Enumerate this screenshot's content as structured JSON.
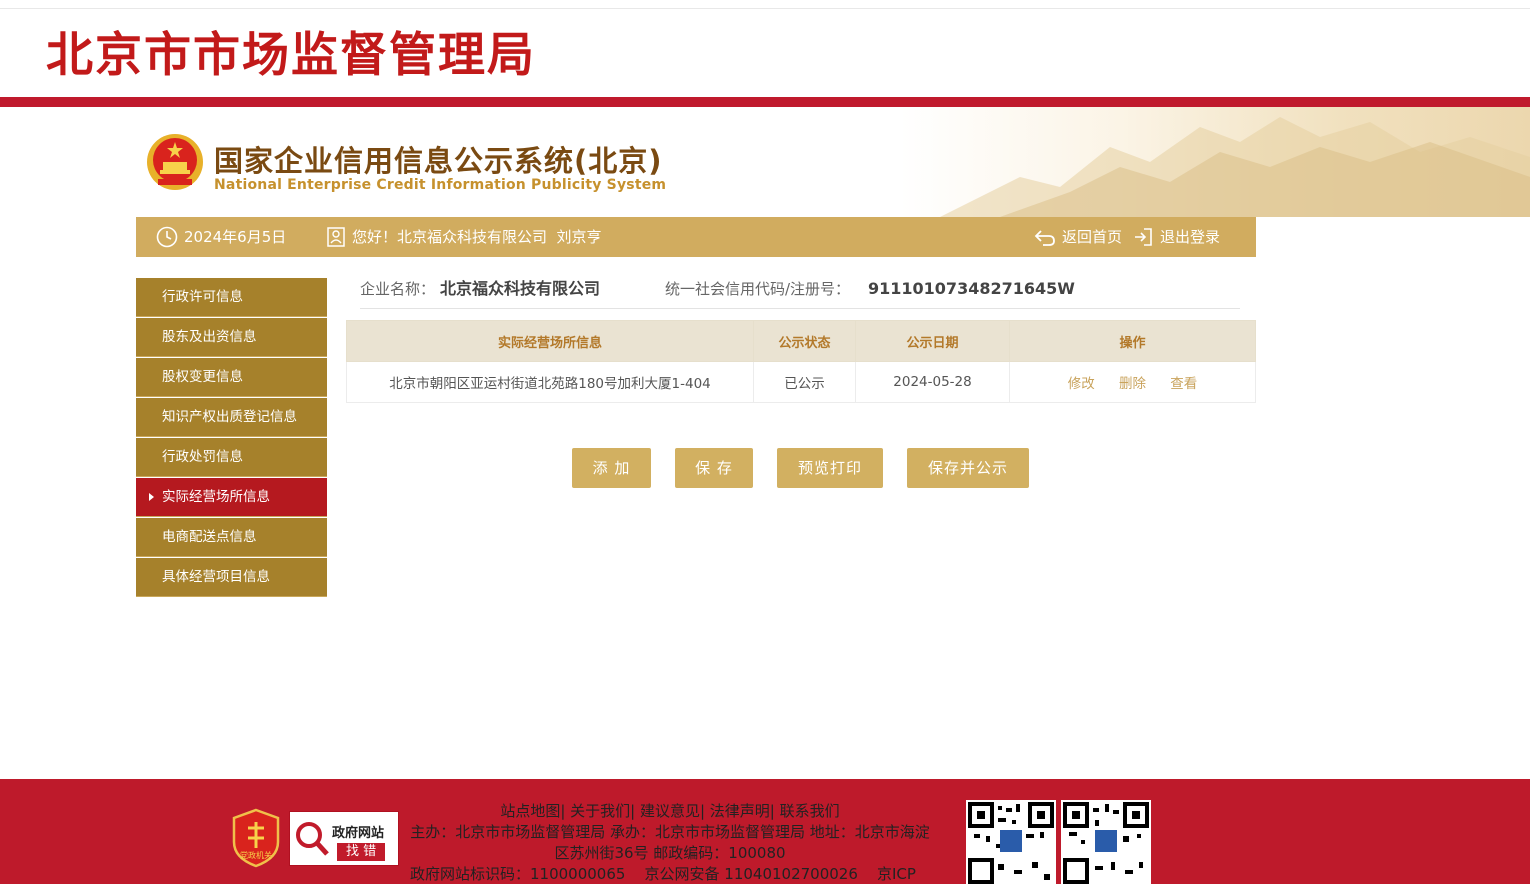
{
  "bureau_title": "北京市市场监督管理局",
  "system": {
    "title_cn": "国家企业信用信息公示系统(北京)",
    "title_en": "National Enterprise Credit Information Publicity System"
  },
  "info_bar": {
    "date": "2024年6月5日",
    "greeting": "您好！北京福众科技有限公司  刘京亨",
    "home_label": "返回首页",
    "logout_label": "退出登录"
  },
  "sidebar": {
    "items": [
      {
        "label": "行政许可信息"
      },
      {
        "label": "股东及出资信息"
      },
      {
        "label": "股权变更信息"
      },
      {
        "label": "知识产权出质登记信息"
      },
      {
        "label": "行政处罚信息"
      },
      {
        "label": "实际经营场所信息",
        "active": true
      },
      {
        "label": "电商配送点信息"
      },
      {
        "label": "具体经营项目信息"
      }
    ]
  },
  "company": {
    "name_label": "企业名称：",
    "name_value": "北京福众科技有限公司",
    "code_label": "统一社会信用代码/注册号：",
    "code_value": "91110107348271645W"
  },
  "table": {
    "headers": [
      "实际经营场所信息",
      "公示状态",
      "公示日期",
      "操作"
    ],
    "rows": [
      {
        "address": "北京市朝阳区亚运村街道北苑路180号加利大厦1-404",
        "status": "已公示",
        "date": "2024-05-28",
        "ops": [
          "修改",
          "删除",
          "查看"
        ]
      }
    ]
  },
  "buttons": {
    "add": "添 加",
    "save": "保 存",
    "preview": "预览打印",
    "save_publish": "保存并公示"
  },
  "footer": {
    "links": "站点地图| 关于我们| 建议意见| 法律声明| 联系我们",
    "line2": "主办：北京市市场监督管理局 承办：北京市市场监督管理局 地址：北京市海淀区苏州街36号 邮政编码：100080",
    "line3": "政府网站标识码：1100000065    京公网安备 11040102700026    京ICP",
    "gov_badge_line1": "政府网站",
    "gov_badge_line2": "找 错",
    "party_badge": "党政机关"
  },
  "colors": {
    "brand_red": "#c01a2d",
    "gold": "#d1ac5f",
    "sidebar_gold": "#a6812b",
    "active_red": "#b5191f"
  }
}
